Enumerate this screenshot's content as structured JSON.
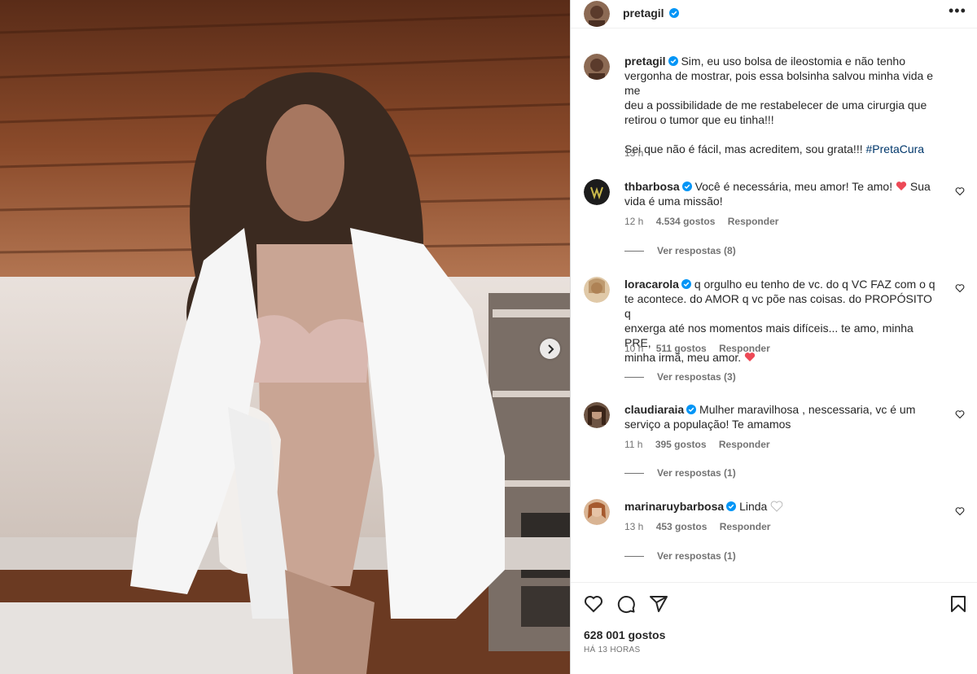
{
  "post": {
    "author": "pretagil",
    "more_icon": "more-options-icon",
    "caption_lines": [
      "Sim, eu uso bolsa de ileostomia e não tenho",
      "vergonha de mostrar, pois essa bolsinha salvou minha vida e me",
      "deu a possibilidade de me restabelecer de uma cirurgia que",
      "retirou o tumor que eu tinha!!!"
    ],
    "caption_second": "Sei que não é fácil, mas acreditem, sou grata!!!",
    "hashtag": "#PretaCura",
    "caption_time": "13 h",
    "likes": "628 001 gostos",
    "posted": "HÁ 13 HORAS"
  },
  "comments": [
    {
      "user": "thbarbosa",
      "text_lines": [
        "Você é necessária, meu amor! Te amo! ",
        "vida é uma missão!"
      ],
      "text_tail_1": " Sua",
      "time": "12 h",
      "likes": "4.534 gostos",
      "reply": "Responder",
      "view_replies": "Ver respostas (8)"
    },
    {
      "user": "loracarola",
      "text_lines": [
        "q orgulho eu tenho de vc. do q VC FAZ com o q",
        "te acontece. do AMOR q vc põe nas coisas. do PROPÓSITO q",
        "enxerga até nos momentos mais difíceis... te amo, minha PRE,",
        "minha irmã, meu amor. "
      ],
      "time": "10 h",
      "likes": "511 gostos",
      "reply": "Responder",
      "view_replies": "Ver respostas (3)"
    },
    {
      "user": "claudiaraia",
      "text_lines": [
        "Mulher maravilhosa , nescessaria, vc é um",
        "serviço a população! Te amamos"
      ],
      "time": "11 h",
      "likes": "395 gostos",
      "reply": "Responder",
      "view_replies": "Ver respostas (1)"
    },
    {
      "user": "marinaruybarbosa",
      "text_lines": [
        "Linda "
      ],
      "time": "13 h",
      "likes": "453 gostos",
      "reply": "Responder",
      "view_replies": "Ver respostas (1)"
    }
  ],
  "colors": {
    "verified": "#0095f6",
    "heart_red": "#ed4956",
    "secondary_text": "#737373",
    "hashtag": "#00376b"
  },
  "icons": [
    "like-icon",
    "comment-icon",
    "share-icon",
    "save-icon",
    "next-arrow-icon",
    "verified-icon",
    "heart-icon"
  ]
}
